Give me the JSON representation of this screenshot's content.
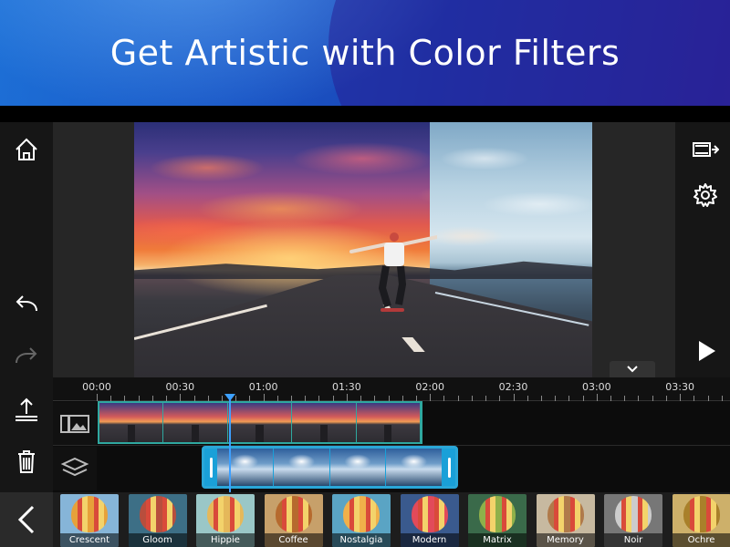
{
  "banner": {
    "title": "Get Artistic with Color Filters"
  },
  "left_toolbar": {
    "items": [
      "home-icon",
      "undo-icon",
      "redo-icon",
      "export-icon",
      "delete-icon"
    ]
  },
  "right_toolbar": {
    "items": [
      "produce-icon",
      "settings-icon",
      "play-icon"
    ]
  },
  "timeline": {
    "ticks": [
      "00:00",
      "00:30",
      "01:00",
      "01:30",
      "02:00",
      "02:30",
      "03:00",
      "03:30"
    ],
    "tracks": [
      "video-track-icon",
      "overlay-track-icon"
    ]
  },
  "filters": {
    "items": [
      "Crescent",
      "Gloom",
      "Hippie",
      "Coffee",
      "Nostalgia",
      "Modern",
      "Matrix",
      "Memory",
      "Noir",
      "Ochre"
    ]
  },
  "colors": {
    "accent": "#2aa7d8",
    "clip_border": "#2fa8a0",
    "playhead": "#3da0ff",
    "banner": "#1b4fc0"
  }
}
